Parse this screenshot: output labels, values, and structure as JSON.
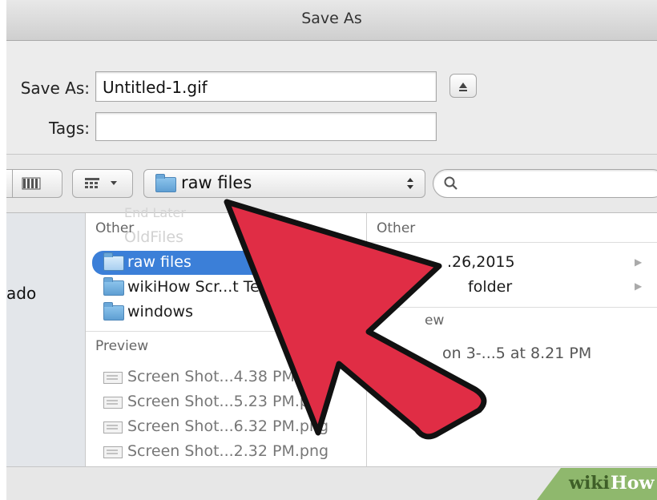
{
  "window": {
    "title": "Save As"
  },
  "form": {
    "save_as_label": "Save As:",
    "save_as_value": "Untitled-1.gif",
    "tags_label": "Tags:",
    "tags_value": ""
  },
  "toolbar": {
    "location_folder": "raw files",
    "search_placeholder": ""
  },
  "sidebar": {
    "partial_item": "ado"
  },
  "column1": {
    "faded_items": [
      "End Later",
      "OldFiles"
    ],
    "section_header": "Other",
    "items": [
      {
        "label": "raw files",
        "selected": true
      },
      {
        "label": "wikiHow Scr...t Te",
        "selected": false
      },
      {
        "label": "windows",
        "selected": false
      }
    ],
    "preview_header": "Preview",
    "preview_items": [
      "Screen Shot...4.38 PM.p",
      "Screen Shot...5.23 PM.pi",
      "Screen Shot...6.32 PM.png",
      "Screen Shot...2.32 PM.png"
    ]
  },
  "column2": {
    "section_header": "Other",
    "items": [
      ".26,2015",
      "folder"
    ],
    "preview_header_partial": "ew",
    "preview_item": "on 3-...5 at 8.21 PM"
  },
  "watermark": {
    "text_a": "wiki",
    "text_b": "How"
  },
  "colors": {
    "selection": "#3b7fd8",
    "arrow": "#e02d45",
    "arrow_outline": "#111111"
  }
}
